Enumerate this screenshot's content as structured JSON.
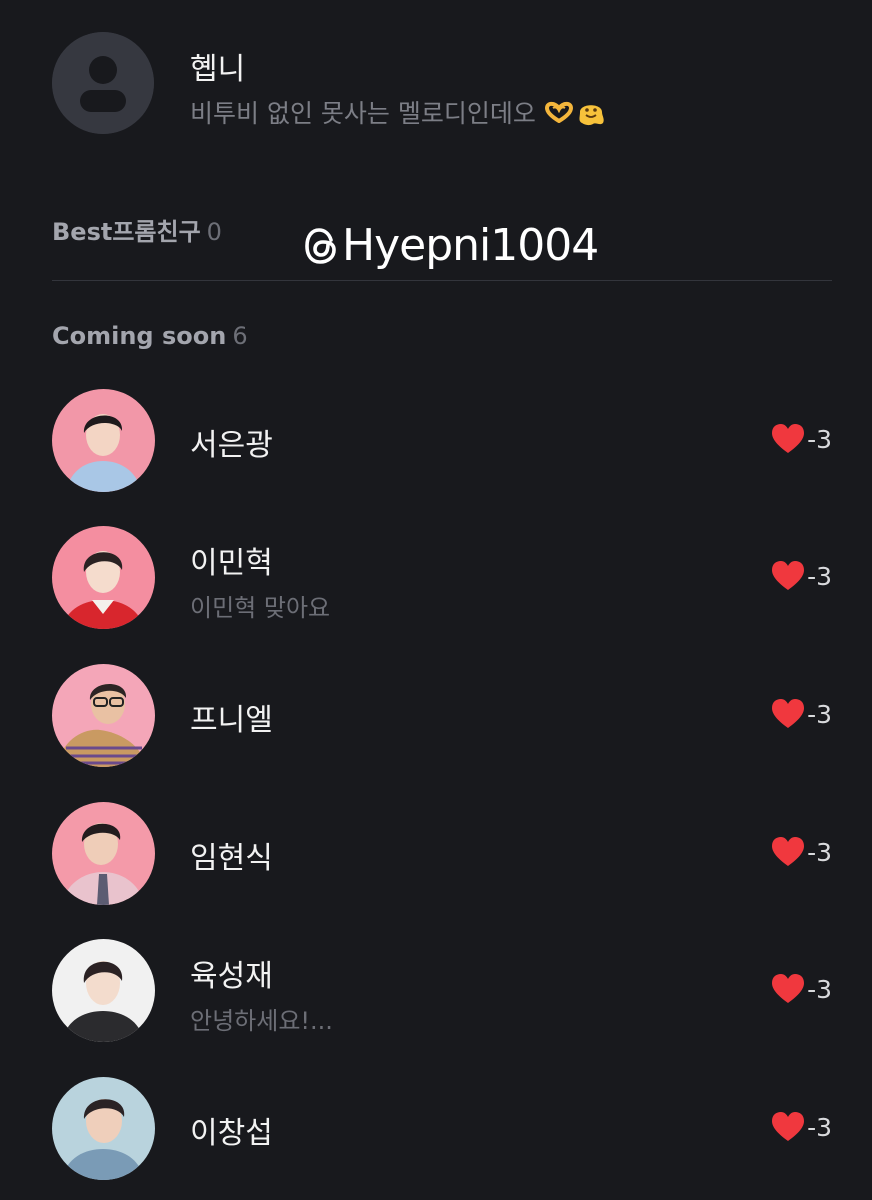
{
  "profile": {
    "name": "혭니",
    "status": "비투비 없인 못사는 멜로디인데오",
    "status_emojis": [
      "heart-hands-icon",
      "melting-face-icon"
    ],
    "avatar_icon": "default-person-icon"
  },
  "best_section": {
    "label": "Best프롬친구",
    "count": "0"
  },
  "watermark": {
    "icon": "threads-logo-icon",
    "handle": "Hyepni1004"
  },
  "coming_section": {
    "label": "Coming soon",
    "count": "6"
  },
  "friends": [
    {
      "name": "서은광",
      "status": "",
      "score": "-3",
      "bg": "#f297a8",
      "shirt": "#a9c7e6"
    },
    {
      "name": "이민혁",
      "status": "이민혁 맞아요",
      "score": "-3",
      "bg": "#f48ea0",
      "shirt": "#d8262d"
    },
    {
      "name": "프니엘",
      "status": "",
      "score": "-3",
      "bg": "#f4a6b8",
      "shirt": "#c99a62"
    },
    {
      "name": "임현식",
      "status": "",
      "score": "-3",
      "bg": "#f49aa9",
      "shirt": "#e9c3cd"
    },
    {
      "name": "육성재",
      "status": "안녕하세요!...",
      "score": "-3",
      "bg": "#f1f1f1",
      "shirt": "#2b2b2e"
    },
    {
      "name": "이창섭",
      "status": "",
      "score": "-3",
      "bg": "#b9d3dd",
      "shirt": "#7a9bb6"
    }
  ],
  "colors": {
    "background": "#18191d",
    "heart": "#f0383e",
    "muted_text": "#7c7e86"
  }
}
